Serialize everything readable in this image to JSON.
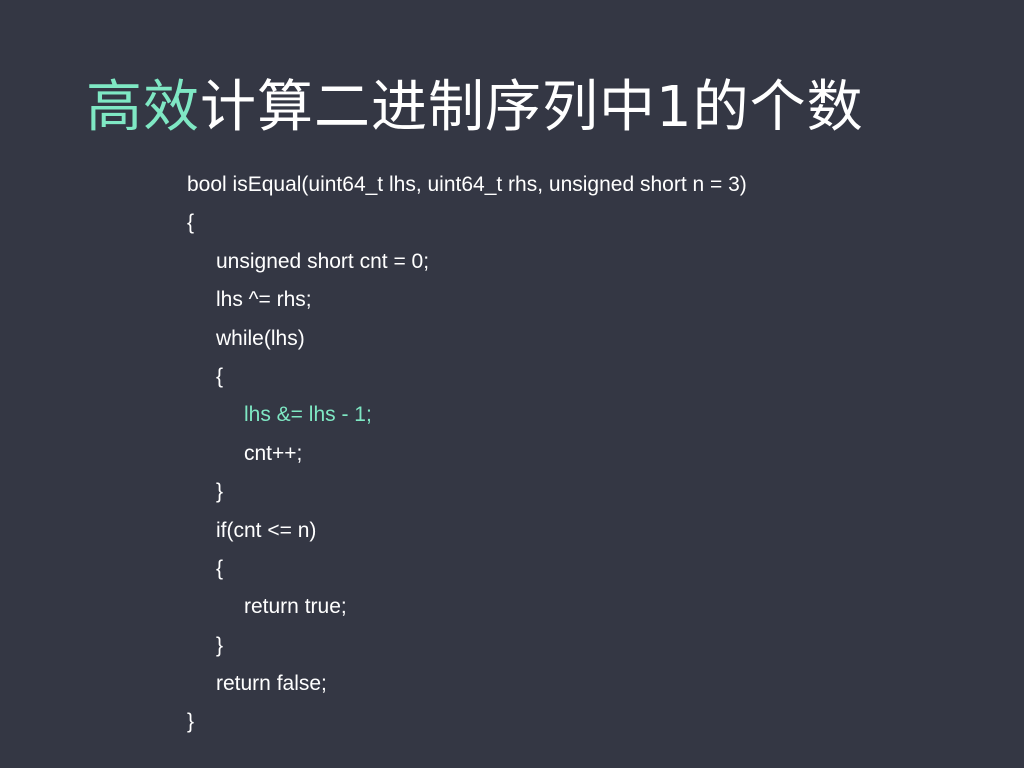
{
  "slide": {
    "title_highlight": "高效",
    "title_rest": "计算二进制序列中1的个数",
    "accent_color": "#7fe8c4",
    "background_color": "#343744",
    "code_lines": [
      {
        "indent": 0,
        "text": "bool isEqual(uint64_t lhs, uint64_t rhs, unsigned short n = 3)",
        "highlight": false
      },
      {
        "indent": 0,
        "text": "{",
        "highlight": false
      },
      {
        "indent": 1,
        "text": "unsigned short cnt = 0;",
        "highlight": false
      },
      {
        "indent": 1,
        "text": "lhs ^= rhs;",
        "highlight": false
      },
      {
        "indent": 1,
        "text": "while(lhs)",
        "highlight": false
      },
      {
        "indent": 1,
        "text": "{",
        "highlight": false
      },
      {
        "indent": 2,
        "text": "lhs &= lhs - 1;",
        "highlight": true
      },
      {
        "indent": 2,
        "text": "cnt++;",
        "highlight": false
      },
      {
        "indent": 1,
        "text": "}",
        "highlight": false
      },
      {
        "indent": 1,
        "text": "if(cnt <= n)",
        "highlight": false
      },
      {
        "indent": 1,
        "text": "{",
        "highlight": false
      },
      {
        "indent": 2,
        "text": "return true;",
        "highlight": false
      },
      {
        "indent": 1,
        "text": "}",
        "highlight": false
      },
      {
        "indent": 1,
        "text": "return false;",
        "highlight": false
      },
      {
        "indent": 0,
        "text": "}",
        "highlight": false
      }
    ]
  }
}
